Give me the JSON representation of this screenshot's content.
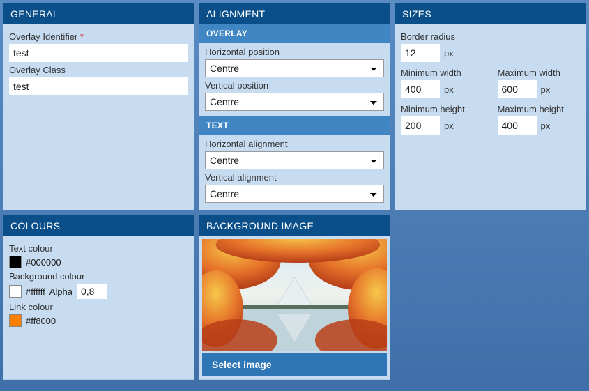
{
  "general": {
    "header": "GENERAL",
    "identifier_label": "Overlay Identifier",
    "identifier_required": "*",
    "identifier_value": "test",
    "class_label": "Overlay Class",
    "class_value": "test"
  },
  "alignment": {
    "header": "ALIGNMENT",
    "overlay_sub": "OVERLAY",
    "hpos_label": "Horizontal position",
    "hpos_value": "Centre",
    "vpos_label": "Vertical position",
    "vpos_value": "Centre",
    "text_sub": "TEXT",
    "halign_label": "Horizontal alignment",
    "halign_value": "Centre",
    "valign_label": "Vertical alignment",
    "valign_value": "Centre"
  },
  "sizes": {
    "header": "SIZES",
    "border_radius_label": "Border radius",
    "border_radius_value": "12",
    "unit": "px",
    "min_w_label": "Minimum width",
    "min_w_value": "400",
    "max_w_label": "Maximum width",
    "max_w_value": "600",
    "min_h_label": "Minimum height",
    "min_h_value": "200",
    "max_h_label": "Maximum height",
    "max_h_value": "400"
  },
  "colours": {
    "header": "COLOURS",
    "text_label": "Text colour",
    "text_value": "#000000",
    "bg_label": "Background colour",
    "bg_value": "#ffffff",
    "alpha_label": "Alpha",
    "alpha_value": "0,8",
    "link_label": "Link colour",
    "link_value": "#ff8000"
  },
  "bgimage": {
    "header": "BACKGROUND IMAGE",
    "btn": "Select image"
  }
}
